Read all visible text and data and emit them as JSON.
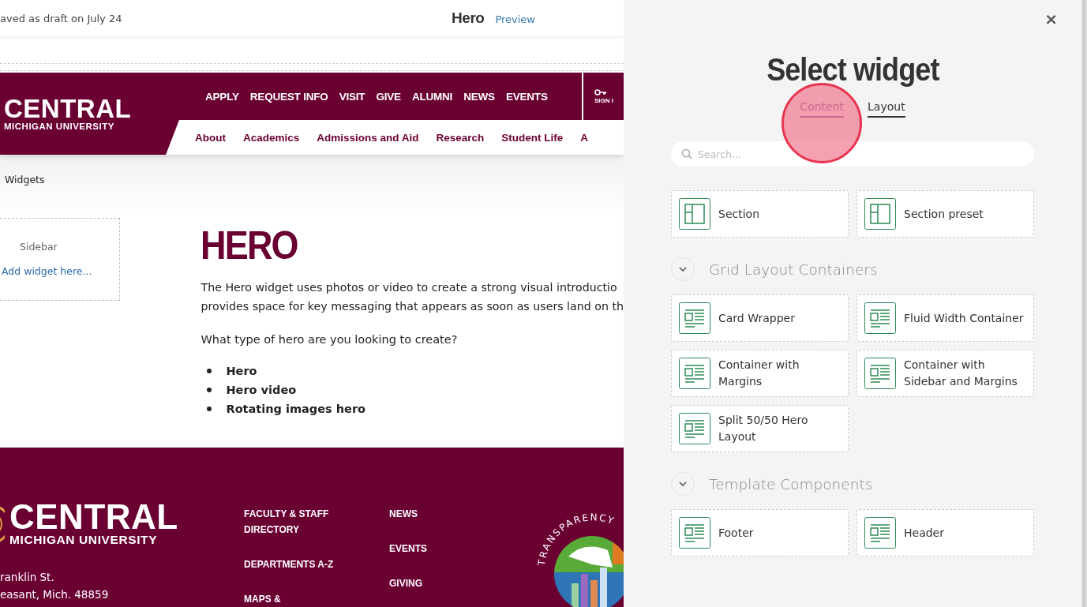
{
  "editor_bar": {
    "status": "aved as draft on July 24",
    "page_title": "Hero",
    "preview_link": "Preview"
  },
  "site_header": {
    "logo": {
      "name": "CENTRAL",
      "subtitle": "MICHIGAN UNIVERSITY"
    },
    "utility_nav": [
      "APPLY",
      "REQUEST INFO",
      "VISIT",
      "GIVE",
      "ALUMNI",
      "NEWS",
      "EVENTS"
    ],
    "sign_in": "SIGN I",
    "main_nav": [
      "About",
      "Academics",
      "Admissions and Aid",
      "Research",
      "Student Life",
      "A"
    ]
  },
  "breadcrumb": "Widgets",
  "sidebar": {
    "label": "Sidebar",
    "add_link": "Add widget here..."
  },
  "content": {
    "heading": "HERO",
    "paragraph_lines": [
      "The Hero widget uses photos or video to create a strong visual introductio",
      "provides space for key messaging that appears as soon as users land on th"
    ],
    "question": "What type of hero are you looking to create?",
    "list": [
      "Hero",
      "Hero video",
      "Rotating images hero"
    ]
  },
  "footer": {
    "logo": {
      "name": "CENTRAL",
      "subtitle": "MICHIGAN UNIVERSITY"
    },
    "address": [
      "ranklin St.",
      "easant, Mich. 48859"
    ],
    "links_1": [
      "FACULTY & STAFF DIRECTORY",
      "DEPARTMENTS A-Z",
      "MAPS &"
    ],
    "links_2": [
      "NEWS",
      "EVENTS",
      "GIVING"
    ],
    "seal_text": "TRANSPARENCY"
  },
  "widget_panel": {
    "close": "×",
    "title": "Select widget",
    "tabs": [
      {
        "label": "Content",
        "selected": true
      },
      {
        "label": "Layout",
        "selected": false
      }
    ],
    "search": {
      "placeholder": "Search..."
    },
    "groups": [
      {
        "items": [
          {
            "label": "Section",
            "kind": "section"
          },
          {
            "label": "Section preset",
            "kind": "section"
          }
        ]
      },
      {
        "title": "Grid Layout Containers",
        "items": [
          {
            "label": "Card Wrapper",
            "kind": "layout"
          },
          {
            "label": "Fluid Width Container",
            "kind": "layout"
          },
          {
            "label": "Container with Margins",
            "kind": "layout"
          },
          {
            "label": "Container with Sidebar and Margins",
            "kind": "layout"
          },
          {
            "label": "Split 50/50 Hero Layout",
            "kind": "layout"
          }
        ]
      },
      {
        "title": "Template Components",
        "items": [
          {
            "label": "Footer",
            "kind": "layout"
          },
          {
            "label": "Header",
            "kind": "layout"
          }
        ]
      }
    ]
  }
}
